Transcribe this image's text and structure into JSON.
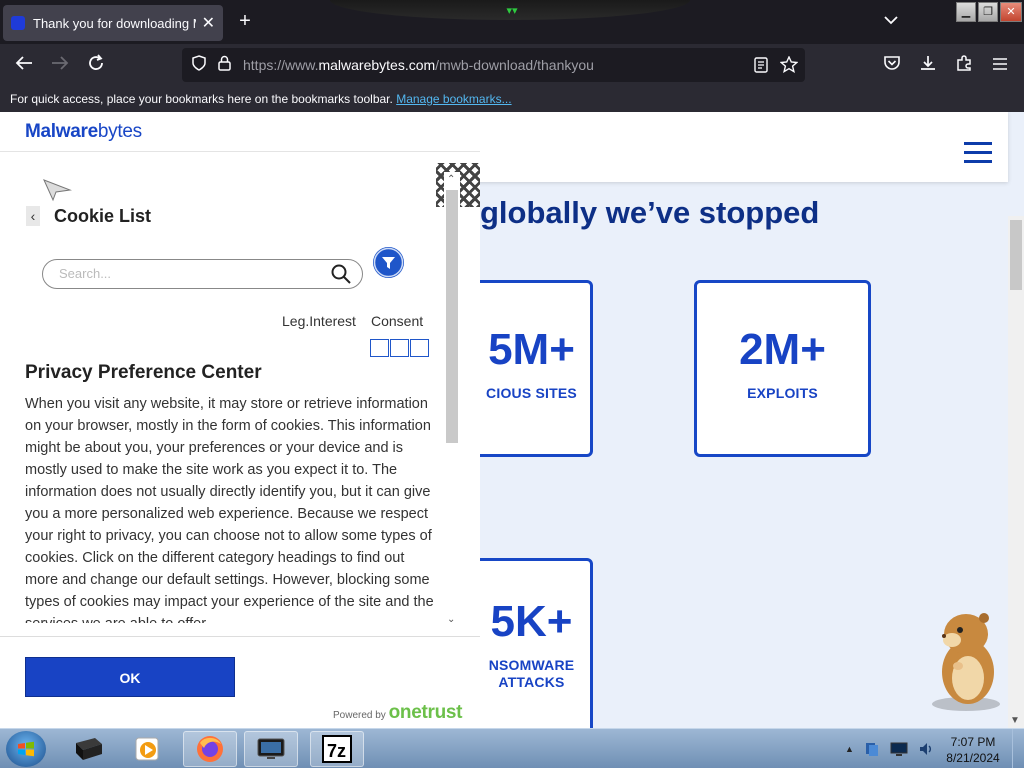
{
  "browser": {
    "tab_title": "Thank you for downloading Ma",
    "tab_close": "✕",
    "new_tab": "+",
    "tab_list": "⌄",
    "url_prefix": "https://www.",
    "url_domain": "malwarebytes.com",
    "url_path": "/mwb-download/thankyou",
    "bookmarks_text": "For quick access, place your bookmarks here on the bookmarks toolbar.",
    "bookmarks_link": "Manage bookmarks..."
  },
  "page": {
    "headline": "globally we’ve stopped",
    "stats": [
      {
        "number": "5M+",
        "label": "CIOUS SITES"
      },
      {
        "number": "2M+",
        "label": "EXPLOITS"
      },
      {
        "number": "5K+",
        "label_line1": "NSOMWARE",
        "label_line2": "ATTACKS"
      }
    ]
  },
  "cookie_panel": {
    "logo_bold": "Malware",
    "logo_rest": "bytes",
    "back_glyph": "‹",
    "title": "Cookie List",
    "search_placeholder": "Search...",
    "col_leg_interest": "Leg.Interest",
    "col_consent": "Consent",
    "privacy_title": "Privacy Preference Center",
    "privacy_body": "When you visit any website, it may store or retrieve information on your browser, mostly in the form of cookies. This information might be about you, your preferences or your device and is mostly used to make the site work as you expect it to. The information does not usually directly identify you, but it can give you a more personalized web experience. Because we respect your right to privacy, you can choose not to allow some types of cookies. Click on the different category headings to find out more and change our default settings. However, blocking some types of cookies may impact your experience of the site and the services we are able to offer.",
    "ok_label": "OK",
    "powered_by": "Powered by",
    "onetrust": "onetrust"
  },
  "taskbar": {
    "time": "7:07 PM",
    "date": "8/21/2024"
  },
  "colors": {
    "brand_blue": "#1843c4",
    "headline_navy": "#0d2f86",
    "onetrust_green": "#6cc04a"
  }
}
